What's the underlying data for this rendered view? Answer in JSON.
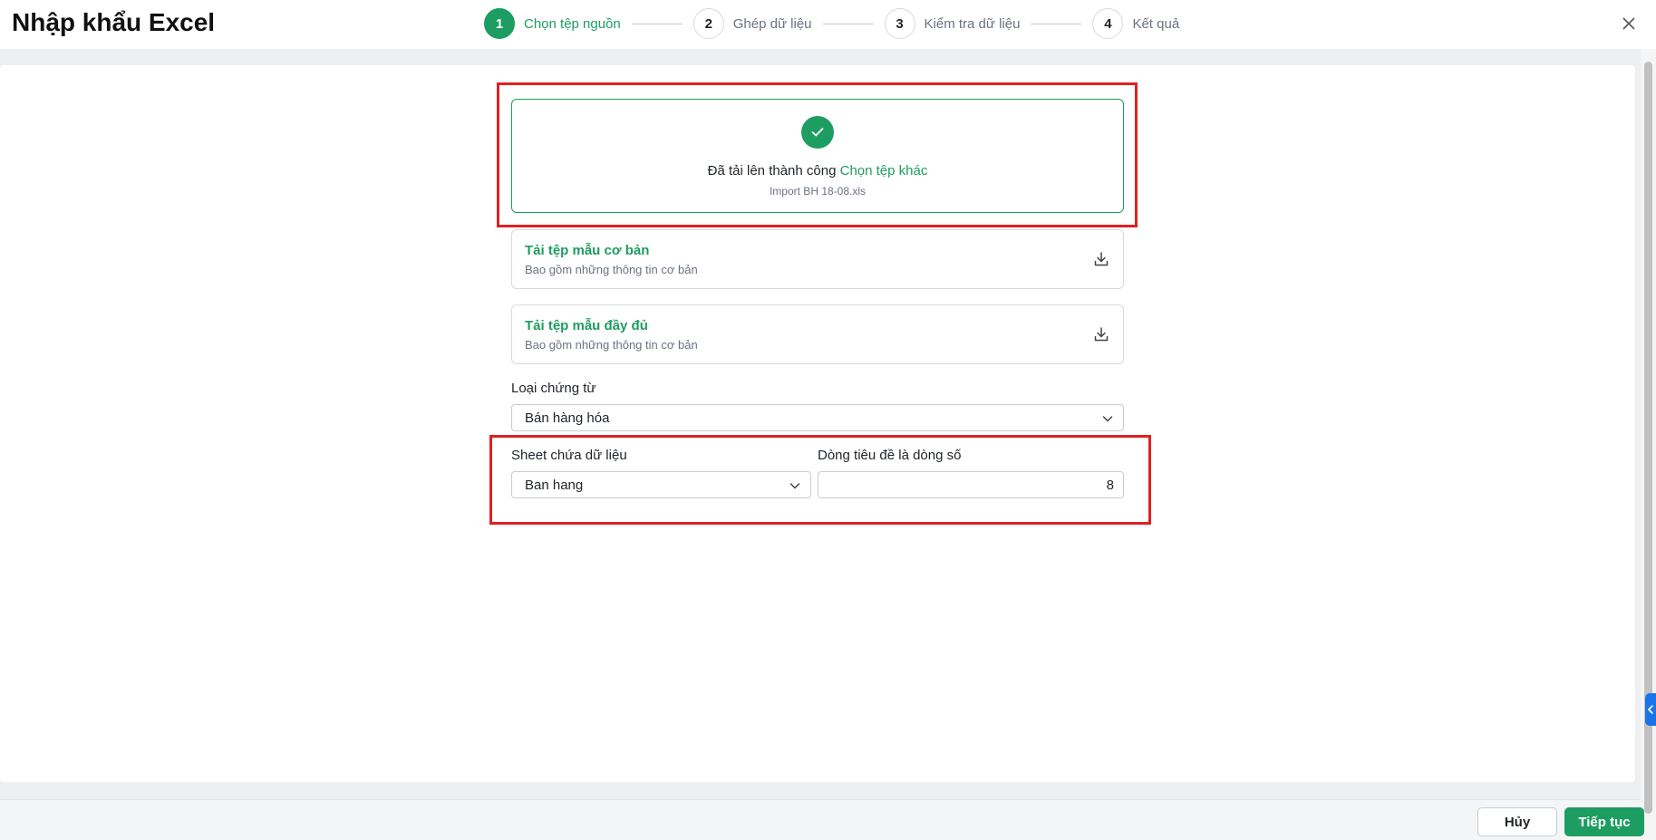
{
  "header": {
    "title": "Nhập khẩu Excel",
    "steps": [
      {
        "num": "1",
        "label": "Chọn tệp nguồn"
      },
      {
        "num": "2",
        "label": "Ghép dữ liệu"
      },
      {
        "num": "3",
        "label": "Kiểm tra dữ liệu"
      },
      {
        "num": "4",
        "label": "Kết quả"
      }
    ],
    "active_step": 1,
    "close_icon": "close-icon"
  },
  "upload": {
    "status_text": "Đã tải lên thành công",
    "change_link": "Chọn tệp khác",
    "file_name": "Import BH 18-08.xls",
    "status_icon": "check-icon"
  },
  "templates": [
    {
      "title": "Tải tệp mẫu cơ bản",
      "description": "Bao gồm những thông tin cơ bản",
      "icon": "download-icon"
    },
    {
      "title": "Tải tệp mẫu đầy đủ",
      "description": "Bao gồm những thông tin cơ bản",
      "icon": "download-icon"
    }
  ],
  "form": {
    "document_type_label": "Loại chứng từ",
    "document_type_value": "Bán hàng hóa",
    "sheet_label": "Sheet chứa dữ liệu",
    "sheet_value": "Ban hang",
    "header_row_label": "Dòng tiêu đề là dòng số",
    "header_row_value": "8"
  },
  "footer": {
    "cancel_label": "Hủy",
    "next_label": "Tiếp tục"
  },
  "colors": {
    "accent": "#1d9d61",
    "highlight": "#e02020",
    "side_tab": "#1a73e8"
  }
}
